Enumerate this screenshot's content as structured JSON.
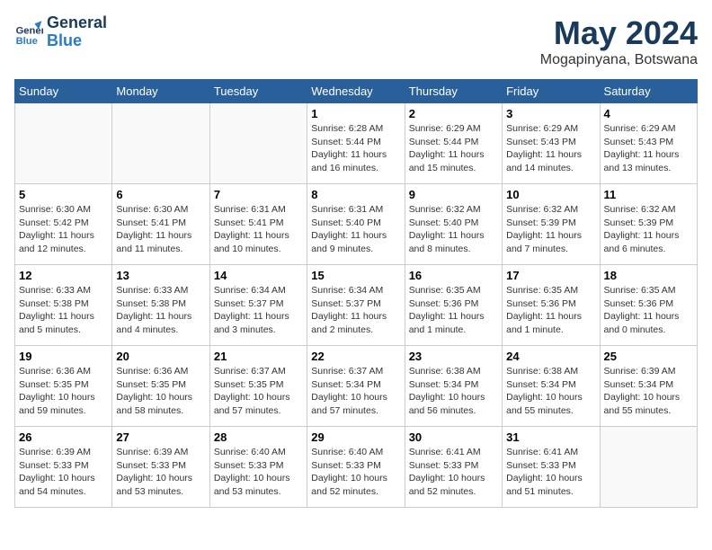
{
  "header": {
    "logo_line1": "General",
    "logo_line2": "Blue",
    "month_title": "May 2024",
    "location": "Mogapinyana, Botswana"
  },
  "days_of_week": [
    "Sunday",
    "Monday",
    "Tuesday",
    "Wednesday",
    "Thursday",
    "Friday",
    "Saturday"
  ],
  "weeks": [
    [
      {
        "day": "",
        "info": ""
      },
      {
        "day": "",
        "info": ""
      },
      {
        "day": "",
        "info": ""
      },
      {
        "day": "1",
        "info": "Sunrise: 6:28 AM\nSunset: 5:44 PM\nDaylight: 11 hours\nand 16 minutes."
      },
      {
        "day": "2",
        "info": "Sunrise: 6:29 AM\nSunset: 5:44 PM\nDaylight: 11 hours\nand 15 minutes."
      },
      {
        "day": "3",
        "info": "Sunrise: 6:29 AM\nSunset: 5:43 PM\nDaylight: 11 hours\nand 14 minutes."
      },
      {
        "day": "4",
        "info": "Sunrise: 6:29 AM\nSunset: 5:43 PM\nDaylight: 11 hours\nand 13 minutes."
      }
    ],
    [
      {
        "day": "5",
        "info": "Sunrise: 6:30 AM\nSunset: 5:42 PM\nDaylight: 11 hours\nand 12 minutes."
      },
      {
        "day": "6",
        "info": "Sunrise: 6:30 AM\nSunset: 5:41 PM\nDaylight: 11 hours\nand 11 minutes."
      },
      {
        "day": "7",
        "info": "Sunrise: 6:31 AM\nSunset: 5:41 PM\nDaylight: 11 hours\nand 10 minutes."
      },
      {
        "day": "8",
        "info": "Sunrise: 6:31 AM\nSunset: 5:40 PM\nDaylight: 11 hours\nand 9 minutes."
      },
      {
        "day": "9",
        "info": "Sunrise: 6:32 AM\nSunset: 5:40 PM\nDaylight: 11 hours\nand 8 minutes."
      },
      {
        "day": "10",
        "info": "Sunrise: 6:32 AM\nSunset: 5:39 PM\nDaylight: 11 hours\nand 7 minutes."
      },
      {
        "day": "11",
        "info": "Sunrise: 6:32 AM\nSunset: 5:39 PM\nDaylight: 11 hours\nand 6 minutes."
      }
    ],
    [
      {
        "day": "12",
        "info": "Sunrise: 6:33 AM\nSunset: 5:38 PM\nDaylight: 11 hours\nand 5 minutes."
      },
      {
        "day": "13",
        "info": "Sunrise: 6:33 AM\nSunset: 5:38 PM\nDaylight: 11 hours\nand 4 minutes."
      },
      {
        "day": "14",
        "info": "Sunrise: 6:34 AM\nSunset: 5:37 PM\nDaylight: 11 hours\nand 3 minutes."
      },
      {
        "day": "15",
        "info": "Sunrise: 6:34 AM\nSunset: 5:37 PM\nDaylight: 11 hours\nand 2 minutes."
      },
      {
        "day": "16",
        "info": "Sunrise: 6:35 AM\nSunset: 5:36 PM\nDaylight: 11 hours\nand 1 minute."
      },
      {
        "day": "17",
        "info": "Sunrise: 6:35 AM\nSunset: 5:36 PM\nDaylight: 11 hours\nand 1 minute."
      },
      {
        "day": "18",
        "info": "Sunrise: 6:35 AM\nSunset: 5:36 PM\nDaylight: 11 hours\nand 0 minutes."
      }
    ],
    [
      {
        "day": "19",
        "info": "Sunrise: 6:36 AM\nSunset: 5:35 PM\nDaylight: 10 hours\nand 59 minutes."
      },
      {
        "day": "20",
        "info": "Sunrise: 6:36 AM\nSunset: 5:35 PM\nDaylight: 10 hours\nand 58 minutes."
      },
      {
        "day": "21",
        "info": "Sunrise: 6:37 AM\nSunset: 5:35 PM\nDaylight: 10 hours\nand 57 minutes."
      },
      {
        "day": "22",
        "info": "Sunrise: 6:37 AM\nSunset: 5:34 PM\nDaylight: 10 hours\nand 57 minutes."
      },
      {
        "day": "23",
        "info": "Sunrise: 6:38 AM\nSunset: 5:34 PM\nDaylight: 10 hours\nand 56 minutes."
      },
      {
        "day": "24",
        "info": "Sunrise: 6:38 AM\nSunset: 5:34 PM\nDaylight: 10 hours\nand 55 minutes."
      },
      {
        "day": "25",
        "info": "Sunrise: 6:39 AM\nSunset: 5:34 PM\nDaylight: 10 hours\nand 55 minutes."
      }
    ],
    [
      {
        "day": "26",
        "info": "Sunrise: 6:39 AM\nSunset: 5:33 PM\nDaylight: 10 hours\nand 54 minutes."
      },
      {
        "day": "27",
        "info": "Sunrise: 6:39 AM\nSunset: 5:33 PM\nDaylight: 10 hours\nand 53 minutes."
      },
      {
        "day": "28",
        "info": "Sunrise: 6:40 AM\nSunset: 5:33 PM\nDaylight: 10 hours\nand 53 minutes."
      },
      {
        "day": "29",
        "info": "Sunrise: 6:40 AM\nSunset: 5:33 PM\nDaylight: 10 hours\nand 52 minutes."
      },
      {
        "day": "30",
        "info": "Sunrise: 6:41 AM\nSunset: 5:33 PM\nDaylight: 10 hours\nand 52 minutes."
      },
      {
        "day": "31",
        "info": "Sunrise: 6:41 AM\nSunset: 5:33 PM\nDaylight: 10 hours\nand 51 minutes."
      },
      {
        "day": "",
        "info": ""
      }
    ]
  ]
}
